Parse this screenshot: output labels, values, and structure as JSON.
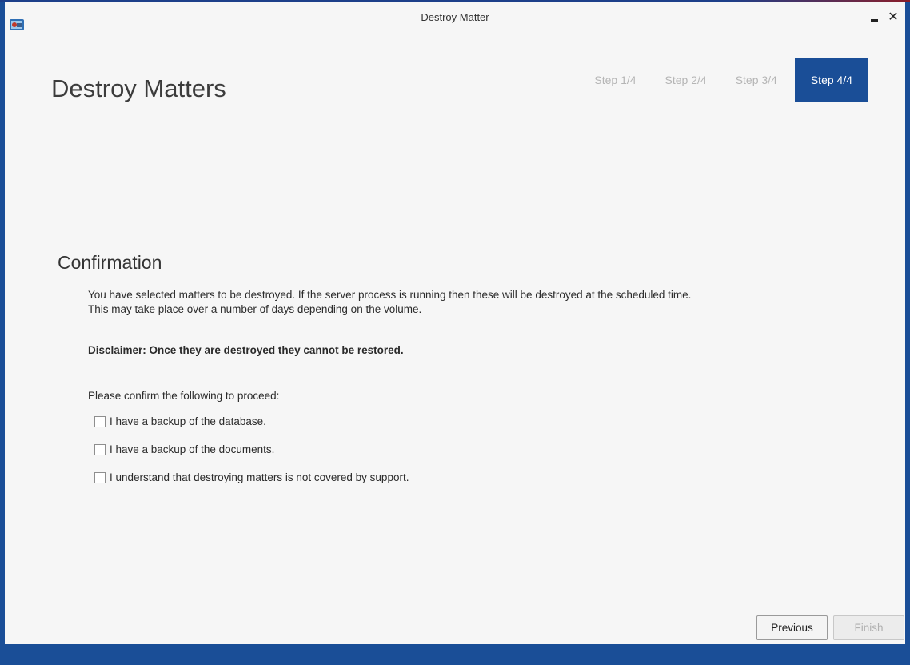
{
  "window": {
    "title": "Destroy Matter",
    "minimize_icon": "minimize-icon",
    "close_icon": "close-icon",
    "close_glyph": "✕",
    "app_icon": "app-icon",
    "accent_color": "#1a4e97"
  },
  "header": {
    "title": "Destroy Matters"
  },
  "steps": [
    {
      "label": "Step 1/4",
      "active": false
    },
    {
      "label": "Step 2/4",
      "active": false
    },
    {
      "label": "Step 3/4",
      "active": false
    },
    {
      "label": "Step 4/4",
      "active": true
    }
  ],
  "confirmation": {
    "title": "Confirmation",
    "description_line1": "You have selected matters to be destroyed. If the server process is running then these will be destroyed at the scheduled time.",
    "description_line2": "This may take place over a number of days depending on the volume.",
    "disclaimer": "Disclaimer: Once they are destroyed they cannot be restored.",
    "prompt": "Please confirm the following to proceed:",
    "checks": [
      {
        "label": "I have a backup of the database.",
        "checked": false
      },
      {
        "label": "I have a backup of the documents.",
        "checked": false
      },
      {
        "label": "I understand that destroying matters is not covered by support.",
        "checked": false
      }
    ]
  },
  "footer": {
    "previous_label": "Previous",
    "finish_label": "Finish",
    "finish_enabled": false
  }
}
